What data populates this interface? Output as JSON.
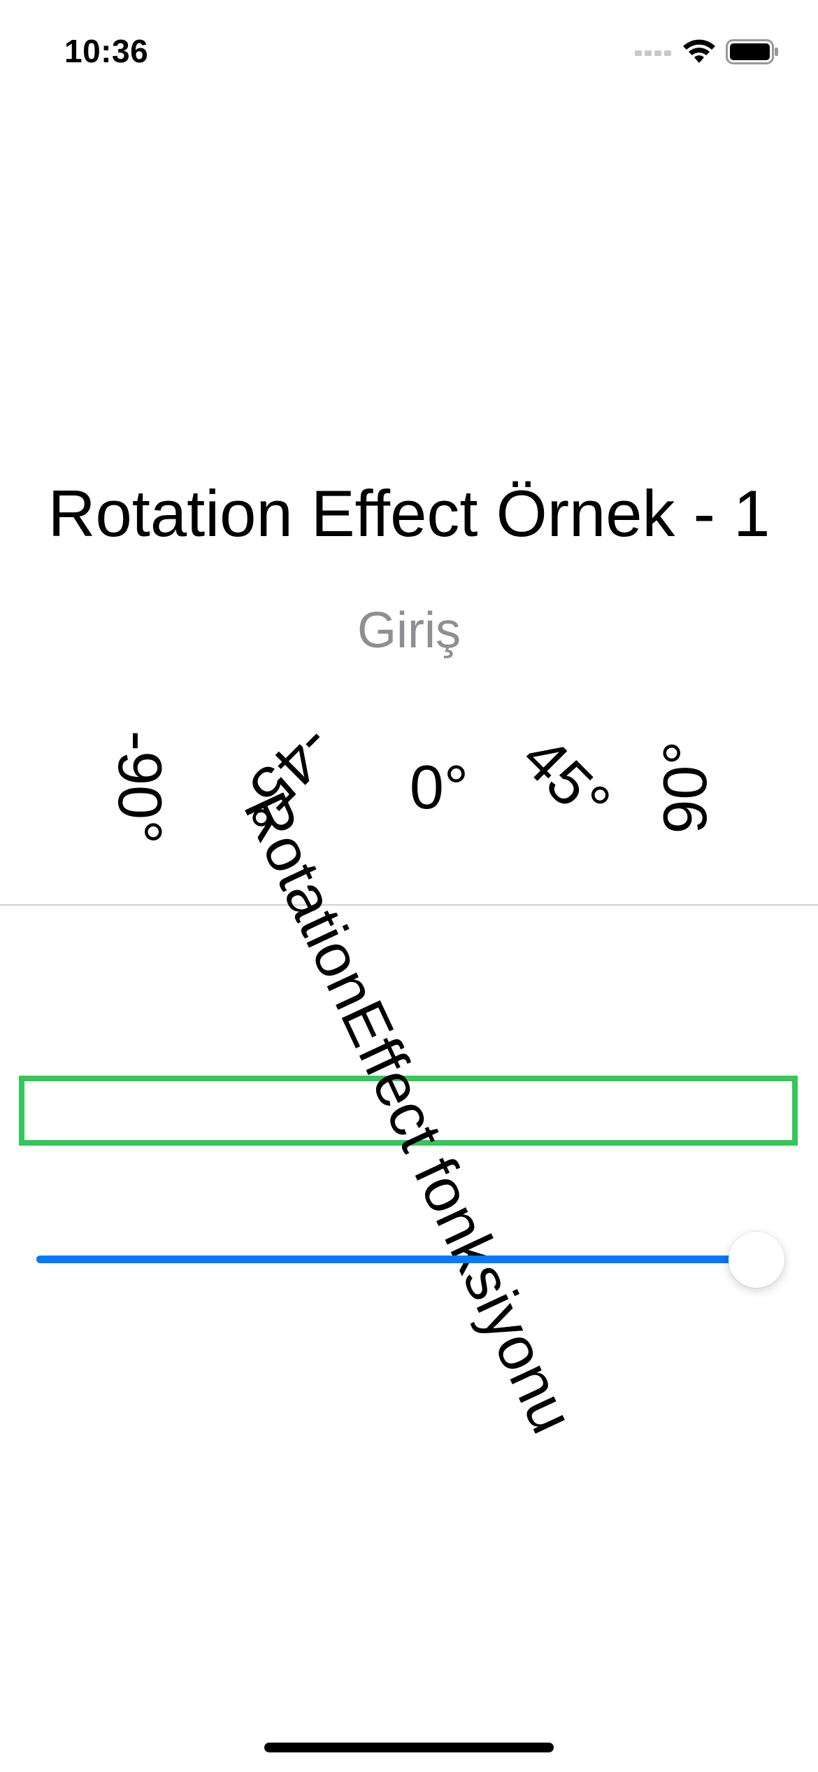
{
  "status_bar": {
    "time": "10:36",
    "icons": [
      "cellular-signal-icon",
      "wifi-icon",
      "battery-icon"
    ]
  },
  "main": {
    "title": "Rotation Effect Örnek - 1",
    "subtitle": "Giriş",
    "angle_labels": [
      {
        "text": "-90°",
        "rotation_deg": 90
      },
      {
        "text": "-45°",
        "rotation_deg": 135
      },
      {
        "text": "0°",
        "rotation_deg": 0
      },
      {
        "text": "45°",
        "rotation_deg": 45
      },
      {
        "text": "90°",
        "rotation_deg": 270
      }
    ],
    "rotated_text": "RotationEffect fonksiyonu",
    "rotated_text_angle_deg": 65,
    "slider": {
      "value_fraction": 1.0
    }
  },
  "colors": {
    "accent": "#007aff",
    "box_border": "#34c759",
    "subtitle": "#8e8e93"
  }
}
